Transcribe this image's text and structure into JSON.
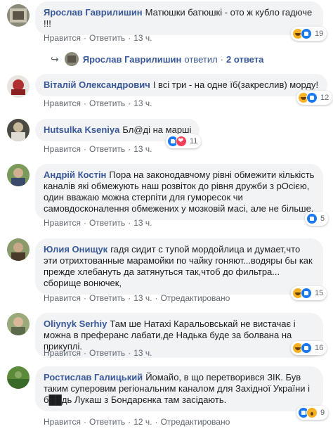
{
  "comments": [
    {
      "author": "Ярослав Гаврилишин",
      "text": "Матюшки батюшкі - ото ж кубло гадюче !!!",
      "like": "Нравится",
      "reply": "Ответить",
      "time": "13 ч.",
      "reactions": [
        "haha",
        "like"
      ],
      "count": "19"
    },
    {
      "author": "Віталій Олександрович",
      "text": "І всі три - на одне їб(закреслив) морду!",
      "like": "Нравится",
      "reply": "Ответить",
      "time": "13 ч.",
      "reactions": [
        "haha",
        "like"
      ],
      "count": "12"
    },
    {
      "author": "Hutsulka Kseniya",
      "text": "Бл@ді на марші",
      "like": "Нравится",
      "reply": "Ответить",
      "time": "13 ч.",
      "reactions": [
        "like",
        "love"
      ],
      "count": "11"
    },
    {
      "author": "Андрій Костін",
      "text": "Пора на законодавчому рівні обмежити кількість каналів які обмежують наш розвіток до рівня дружби з рОсією, один вважаю можна стерпіти для гуморесок чи самовдосконалення обмежених у мозковій масі, але не більше.",
      "like": "Нравится",
      "reply": "Ответить",
      "time": "13 ч.",
      "reactions": [
        "like"
      ],
      "count": "5"
    },
    {
      "author": "Юлия Онищук",
      "text": "гадя сидит с тупой мордойлица и думает,что эти отрихтованные марамойки по чайку гоняют...водяры бы как прежде хлебануть да затянуться так,чтоб до фильтра... сборище вонючек,",
      "like": "Нравится",
      "reply": "Ответить",
      "time": "13 ч.",
      "edited": "Отредактировано",
      "reactions": [
        "haha",
        "like"
      ],
      "count": "15"
    },
    {
      "author": "Oliynyk Serhiy",
      "text": "Там ше Натахі Каральовськай не вистачає і можна в преферанс лабати,де Надька буде за болвана на прикуплі.",
      "like": "Нравится",
      "reply": "Ответить",
      "time": "13 ч.",
      "reactions": [
        "haha",
        "like"
      ],
      "count": "16"
    },
    {
      "author": "Ростислав Галицький",
      "text": "Йомайо, в що перетворився ЗІК. Був таким суперовим регіональним каналом для Західної України і б██дь Лукаш з Бондарєнка там засідають.",
      "like": "Нравится",
      "reply": "Ответить",
      "time": "12 ч.",
      "edited": "Отредактировано",
      "reactions": [
        "like",
        "wow"
      ],
      "count": "9"
    }
  ],
  "reply_thread": {
    "author": "Ярослав Гаврилишин",
    "verb": "ответил",
    "separator": "·",
    "count_text": "2 ответа"
  },
  "separator": "·",
  "colors": {
    "link": "#385898",
    "bubble": "#f2f3f5",
    "meta": "#606770"
  }
}
